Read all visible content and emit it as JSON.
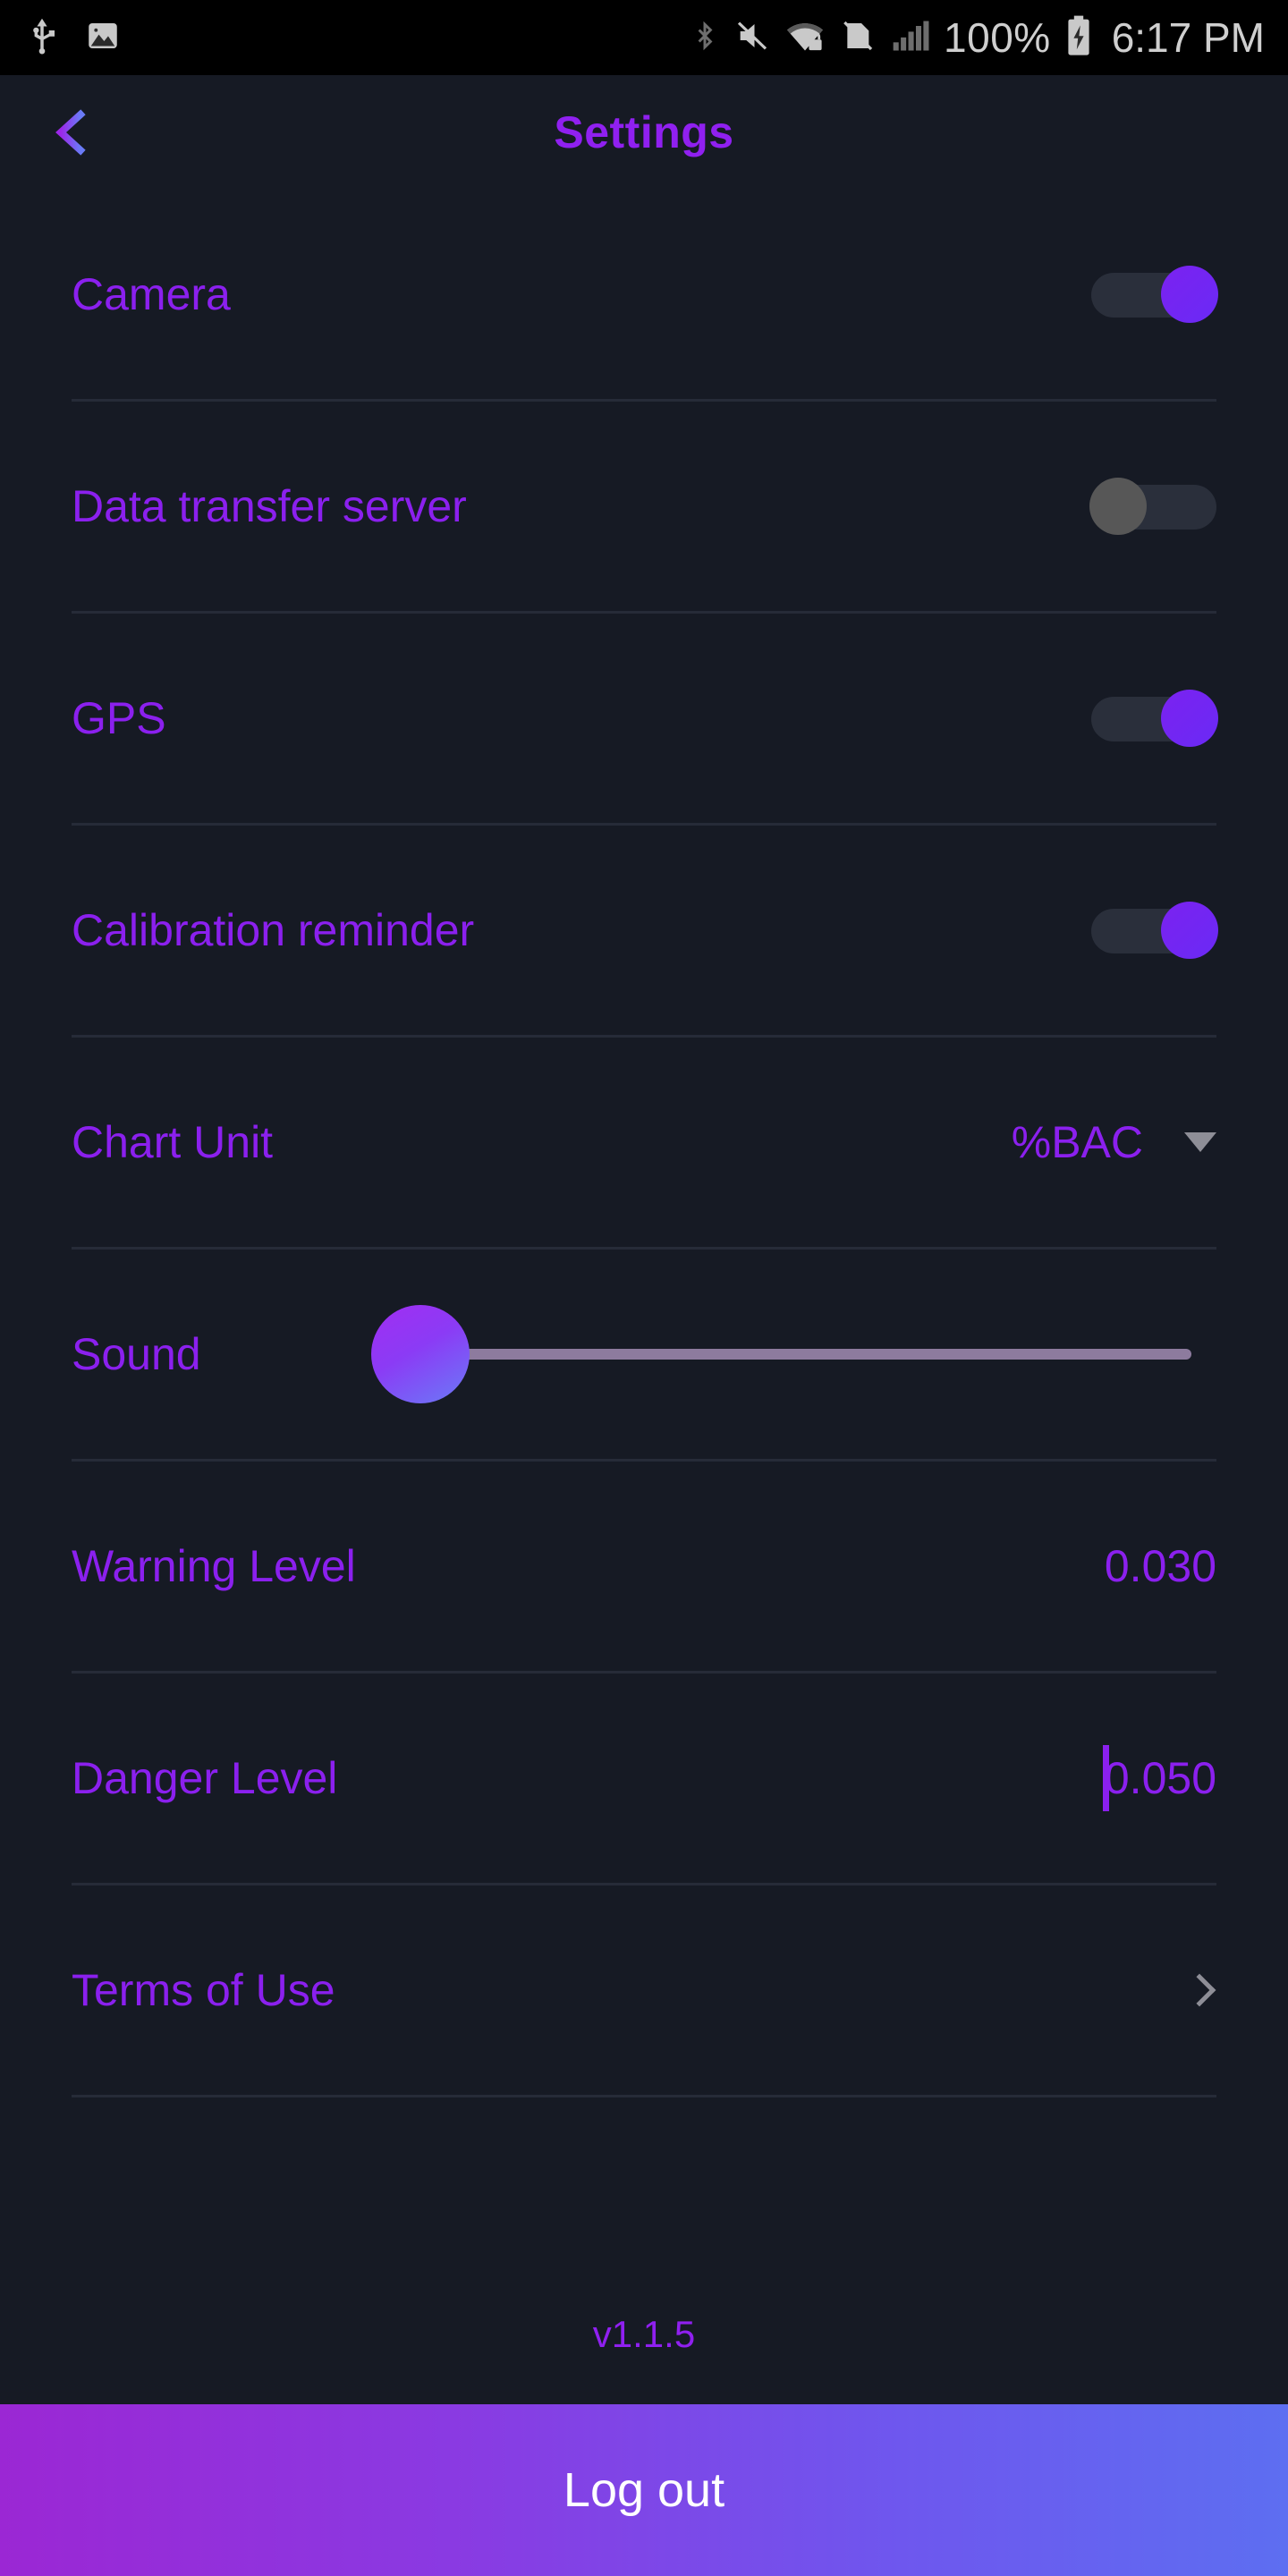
{
  "statusbar": {
    "left_icons": [
      "usb-icon",
      "image-icon"
    ],
    "right_icons": [
      "bluetooth-icon",
      "volume-muted-icon",
      "wifi-locked-icon",
      "sim-disabled-icon",
      "signal-bars-icon"
    ],
    "battery_percent": "100%",
    "battery_icon": "battery-charging-icon",
    "time": "6:17 PM"
  },
  "appbar": {
    "back_icon": "back-arrow-icon",
    "title": "Settings"
  },
  "settings": {
    "rows": [
      {
        "label": "Camera",
        "type": "toggle",
        "state": "on"
      },
      {
        "label": "Data transfer server",
        "type": "toggle",
        "state": "off"
      },
      {
        "label": "GPS",
        "type": "toggle",
        "state": "on"
      },
      {
        "label": "Calibration reminder",
        "type": "toggle",
        "state": "on"
      },
      {
        "label": "Chart Unit",
        "type": "dropdown",
        "value": "%BAC",
        "icon": "chevron-down-icon"
      },
      {
        "label": "Sound",
        "type": "slider",
        "value": "0"
      },
      {
        "label": "Warning Level",
        "type": "input",
        "value": "0.030"
      },
      {
        "label": "Danger Level",
        "type": "input",
        "value": "0.050",
        "focused": "true"
      },
      {
        "label": "Terms of Use",
        "type": "link",
        "icon": "chevron-right-icon"
      }
    ]
  },
  "version": "v1.1.5",
  "logout": {
    "label": "Log out"
  },
  "colors": {
    "background": "#161a24",
    "accent_purple": "#8b20ee",
    "title_purple": "#9020f0",
    "divider": "#262b38",
    "toggle_on": "#7b22f0",
    "toggle_off": "#575757",
    "slider_track": "#8d7b9e",
    "logout_gradient_start": "#9b27d4",
    "logout_gradient_end": "#5d6ef1",
    "statusbar_bg": "#000000",
    "statusbar_text": "#cfcfcf"
  }
}
